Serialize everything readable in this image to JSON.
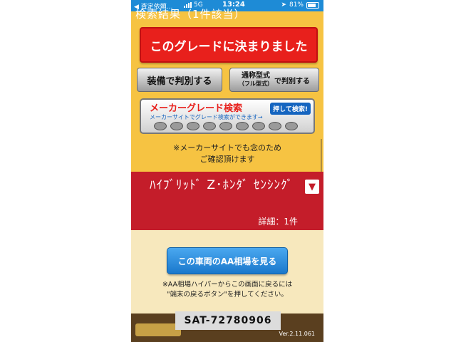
{
  "status_bar": {
    "back_label": "◀ 査定依頼...",
    "network": "5G",
    "time": "13:24",
    "battery": "81%",
    "battery_level_percent": 81
  },
  "header": {
    "title": "検索結果（1件該当）"
  },
  "buttons": {
    "decide_grade": "このグレードに決まりました",
    "by_equipment": "装備で判別する",
    "by_type_main": "通称型式",
    "by_type_sub": "（フル型式）",
    "by_type_suffix": "で判別する"
  },
  "maker_banner": {
    "title": "メーカーグレード検索",
    "subtitle": "メーカーサイトでグレード検索ができます→",
    "search_button": "押して検索!",
    "logo_icons": [
      "toyota-logo-icon",
      "lexus-logo-icon",
      "mazda-logo-icon",
      "subaru-logo-icon",
      "nissan-logo-icon",
      "honda-logo-icon",
      "mitsubishi-logo-icon",
      "suzuki-logo-icon",
      "daihatsu-logo-icon"
    ]
  },
  "notice": {
    "line1": "※メーカーサイトでも念のため",
    "line2": "ご確認頂けます"
  },
  "result": {
    "grade_name": "ﾊｲﾌﾞﾘｯﾄﾞ Z･ﾎﾝﾀﾞ ｾﾝｼﾝｸﾞ",
    "detail": "詳細：1件",
    "dropdown_glyph": "▼"
  },
  "aa": {
    "button": "この車両のAA相場を見る",
    "note_line1": "※AA相場ハイパーからこの画面に戻るには",
    "note_line2": "\"端末の戻るボタン\"を押してください。"
  },
  "footer": {
    "sat_id": "SAT-72780906",
    "version": "Ver.2.11.061"
  },
  "colors": {
    "status_bar": "#1e8bd6",
    "page_background": "#f6c342",
    "primary_red": "#e8201c",
    "result_red": "#c41d2a",
    "aa_blue": "#1a78cc",
    "lower_background": "#f7e8bd",
    "footer_brown": "#5a3f1f"
  }
}
